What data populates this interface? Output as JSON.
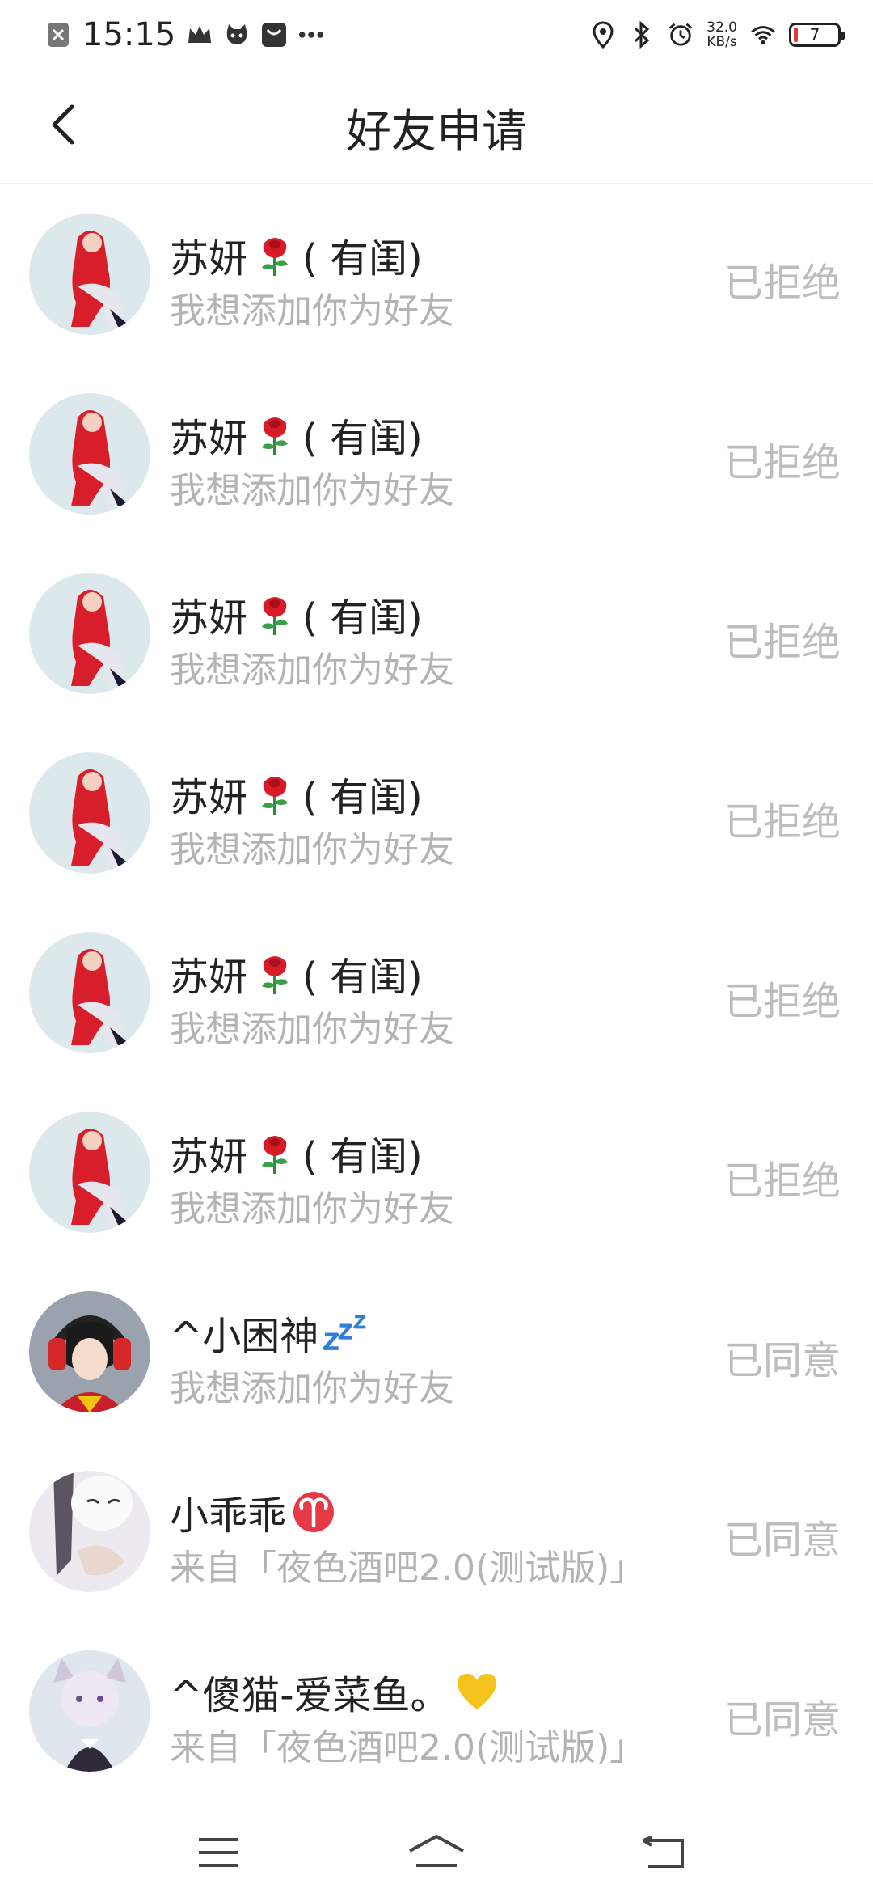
{
  "status_bar": {
    "time": "15:15",
    "net_speed_value": "32.0",
    "net_speed_unit": "KB/s",
    "battery_level": "7"
  },
  "header": {
    "title": "好友申请",
    "back_icon": "chevron-left-icon"
  },
  "requests": [
    {
      "name": "苏妍",
      "name_suffix": "( 有闺)",
      "emoji": "rose",
      "message": "我想添加你为好友",
      "status": "已拒绝",
      "avatar": "red-hair-girl"
    },
    {
      "name": "苏妍",
      "name_suffix": "( 有闺)",
      "emoji": "rose",
      "message": "我想添加你为好友",
      "status": "已拒绝",
      "avatar": "red-hair-girl"
    },
    {
      "name": "苏妍",
      "name_suffix": "( 有闺)",
      "emoji": "rose",
      "message": "我想添加你为好友",
      "status": "已拒绝",
      "avatar": "red-hair-girl"
    },
    {
      "name": "苏妍",
      "name_suffix": "( 有闺)",
      "emoji": "rose",
      "message": "我想添加你为好友",
      "status": "已拒绝",
      "avatar": "red-hair-girl"
    },
    {
      "name": "苏妍",
      "name_suffix": "( 有闺)",
      "emoji": "rose",
      "message": "我想添加你为好友",
      "status": "已拒绝",
      "avatar": "red-hair-girl"
    },
    {
      "name": "苏妍",
      "name_suffix": "( 有闺)",
      "emoji": "rose",
      "message": "我想添加你为好友",
      "status": "已拒绝",
      "avatar": "red-hair-girl"
    },
    {
      "name": "^小困神",
      "name_suffix": "",
      "emoji": "zzz",
      "message": "我想添加你为好友",
      "status": "已同意",
      "avatar": "headphone-boy"
    },
    {
      "name": "小乖乖",
      "name_suffix": "",
      "emoji": "aries",
      "message": "来自「夜色酒吧2.0(测试版)」",
      "status": "已同意",
      "avatar": "mask-girl"
    },
    {
      "name": "^傻猫-爱菜鱼。",
      "name_suffix": "",
      "emoji": "yellow-heart",
      "message": "来自「夜色酒吧2.0(测试版)」",
      "status": "已同意",
      "avatar": "cat-ear-girl"
    }
  ],
  "nav_bar": {
    "icons": [
      "menu-icon",
      "home-icon",
      "back-icon"
    ]
  },
  "colors": {
    "status_text": "#bdbdbd",
    "message_text": "#b3b3b3",
    "avatar_bg": "#dfe9ee"
  }
}
